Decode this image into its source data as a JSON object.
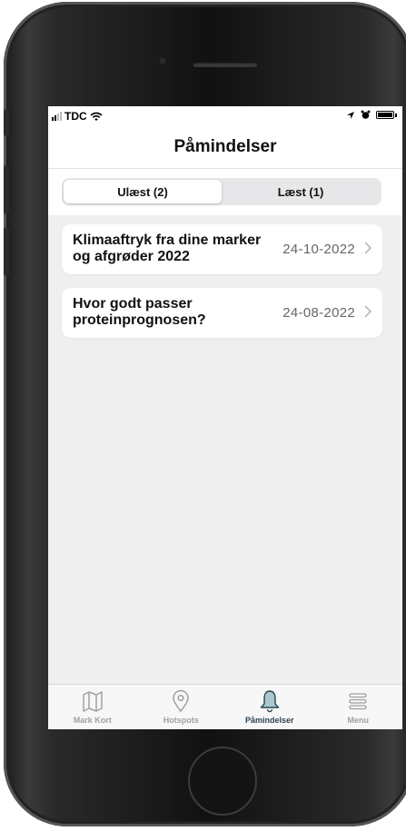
{
  "status_bar": {
    "carrier": "TDC"
  },
  "header": {
    "title": "Påmindelser"
  },
  "segments": [
    {
      "label": "Ulæst (2)",
      "selected": true
    },
    {
      "label": "Læst (1)",
      "selected": false
    }
  ],
  "notifications": [
    {
      "title": "Klimaaftryk fra dine marker og afgrøder 2022",
      "date": "24-10-2022"
    },
    {
      "title": "Hvor godt passer proteinprognosen?",
      "date": "24-08-2022"
    }
  ],
  "tab_bar": {
    "items": [
      {
        "label": "Mark Kort",
        "icon": "map-icon",
        "active": false
      },
      {
        "label": "Hotspots",
        "icon": "location-pin-icon",
        "active": false
      },
      {
        "label": "Påmindelser",
        "icon": "bell-icon",
        "active": true
      },
      {
        "label": "Menu",
        "icon": "menu-icon",
        "active": false
      }
    ]
  },
  "colors": {
    "accent": "#2a4550",
    "bell_fill": "#a9c9cf",
    "inactive": "#a0a0a0",
    "background": "#efefef"
  }
}
